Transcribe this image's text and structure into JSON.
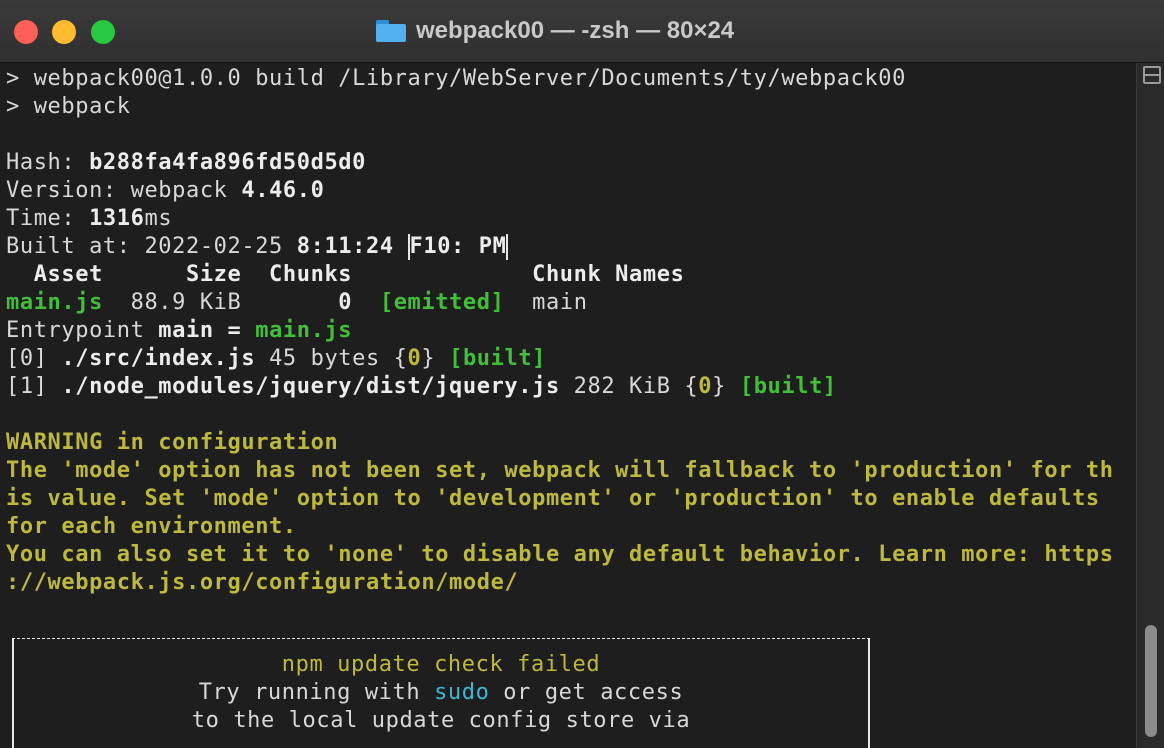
{
  "window": {
    "title": "webpack00 — -zsh — 80×24"
  },
  "terminal": {
    "l1": "> webpack00@1.0.0 build /Library/WebServer/Documents/ty/webpack00",
    "l2": "> webpack",
    "hash_label": "Hash: ",
    "hash_value": "b288fa4fa896fd50d5d0",
    "version_label": "Version: webpack ",
    "version_value": "4.46.0",
    "time_label": "Time: ",
    "time_value": "1316",
    "time_unit": "ms",
    "built_label": "Built at: 2022-02-25 ",
    "built_time": "8:11:24 ",
    "built_suffix": "F10: PM",
    "table_header": "  Asset      Size  Chunks             Chunk Names",
    "asset_name": "main.js",
    "asset_mid": "  88.9 KiB       ",
    "asset_chunk": "0",
    "asset_gap": "  ",
    "asset_status": "[emitted]",
    "asset_names": "  main",
    "ep_label": "Entrypoint ",
    "ep_main": "main = ",
    "ep_file": "main.js",
    "m0_idx": "[0] ",
    "m0_path": "./src/index.js",
    "m0_size": " 45 bytes {",
    "m0_chunk": "0",
    "m0_close": "} ",
    "m0_status": "[built]",
    "m1_idx": "[1] ",
    "m1_path": "./node_modules/jquery/dist/jquery.js",
    "m1_size": " 282 KiB {",
    "m1_chunk": "0",
    "m1_close": "} ",
    "m1_status": "[built]",
    "warn1": "WARNING in configuration",
    "warn2": "The 'mode' option has not been set, webpack will fallback to 'production' for th",
    "warn3": "is value. Set 'mode' option to 'development' or 'production' to enable defaults",
    "warn4": "for each environment.",
    "warn5": "You can also set it to 'none' to disable any default behavior. Learn more: https",
    "warn6": "://webpack.js.org/configuration/mode/",
    "npm1": "npm update check failed",
    "npm2_a": "Try running with ",
    "npm2_b": "sudo",
    "npm2_c": " or get access",
    "npm3": "to the local update config store via"
  },
  "colors": {
    "green": "#42bf38",
    "yellow": "#bdb840",
    "cyan": "#3fb5d4",
    "bg": "#1e1e1e"
  },
  "icons": [
    "folder-icon",
    "scrollbar-toggle-icon"
  ]
}
